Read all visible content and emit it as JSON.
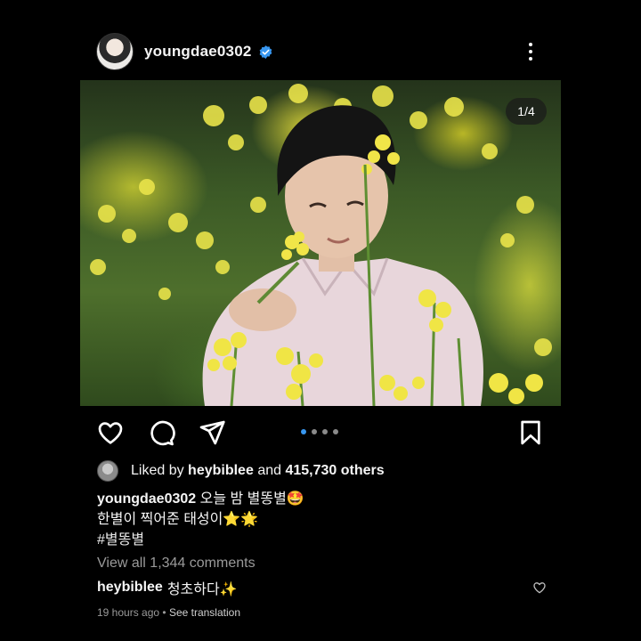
{
  "post": {
    "username": "youngdae0302",
    "photo_counter": "1/4",
    "total_photos": 4,
    "current_photo": 1
  },
  "likes": {
    "prefix": "Liked by",
    "liker": "heybiblee",
    "middle": "and",
    "count_text": "415,730 others"
  },
  "caption": {
    "username": "youngdae0302",
    "line1": "오늘 밤 별똥별🤩",
    "line2": "한별이 찍어준 태성이⭐🌟",
    "line3": "#별똥별"
  },
  "comments": {
    "view_all": "View all 1,344 comments",
    "preview": {
      "username": "heybiblee",
      "text": "청초하다✨"
    }
  },
  "meta": {
    "time": "19 hours ago",
    "separator": " • ",
    "translate": "See translation"
  },
  "icons": {
    "verified": "verified-badge-icon",
    "more": "more-options-icon",
    "like": "heart-icon",
    "comment": "comment-icon",
    "share": "paper-plane-icon",
    "save": "bookmark-icon"
  },
  "colors": {
    "background": "#000000",
    "verified_blue": "#3897f0",
    "active_dot": "#3897f0",
    "muted_text": "#9a9a9a"
  }
}
